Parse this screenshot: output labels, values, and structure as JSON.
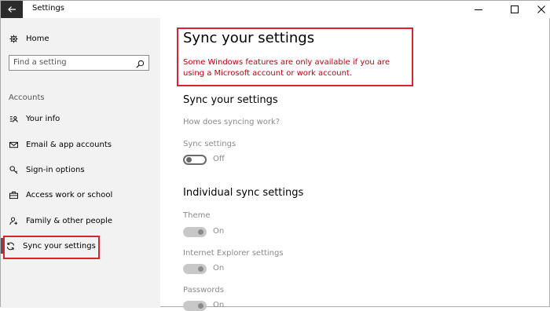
{
  "window": {
    "title": "Settings",
    "back_icon": "arrow-left-icon",
    "minimize_icon": "minimize-icon",
    "maximize_icon": "maximize-icon",
    "close_icon": "close-icon"
  },
  "sidebar": {
    "home_label": "Home",
    "home_icon": "gear-icon",
    "search_placeholder": "Find a setting",
    "search_icon": "search-icon",
    "section_label": "Accounts",
    "items": [
      {
        "label": "Your info",
        "icon": "contact-card-icon"
      },
      {
        "label": "Email & app accounts",
        "icon": "envelope-icon"
      },
      {
        "label": "Sign-in options",
        "icon": "key-icon"
      },
      {
        "label": "Access work or school",
        "icon": "briefcase-icon"
      },
      {
        "label": "Family & other people",
        "icon": "person-add-icon"
      },
      {
        "label": "Sync your settings",
        "icon": "sync-icon",
        "active": true
      }
    ]
  },
  "main": {
    "page_title": "Sync your settings",
    "warning_text": "Some Windows features are only available if you are using a Microsoft account or work account.",
    "section1_heading": "Sync your settings",
    "how_link": "How does syncing work?",
    "sync_settings_label": "Sync settings",
    "sync_settings_state": "Off",
    "section2_heading": "Individual sync settings",
    "individual": [
      {
        "label": "Theme",
        "state": "On"
      },
      {
        "label": "Internet Explorer settings",
        "state": "On"
      },
      {
        "label": "Passwords",
        "state": "On"
      }
    ]
  },
  "colors": {
    "highlight_border": "#d9232e",
    "warning_text": "#c0000c",
    "disabled_text": "#8a8a8a",
    "sidebar_bg": "#f2f2f2"
  }
}
